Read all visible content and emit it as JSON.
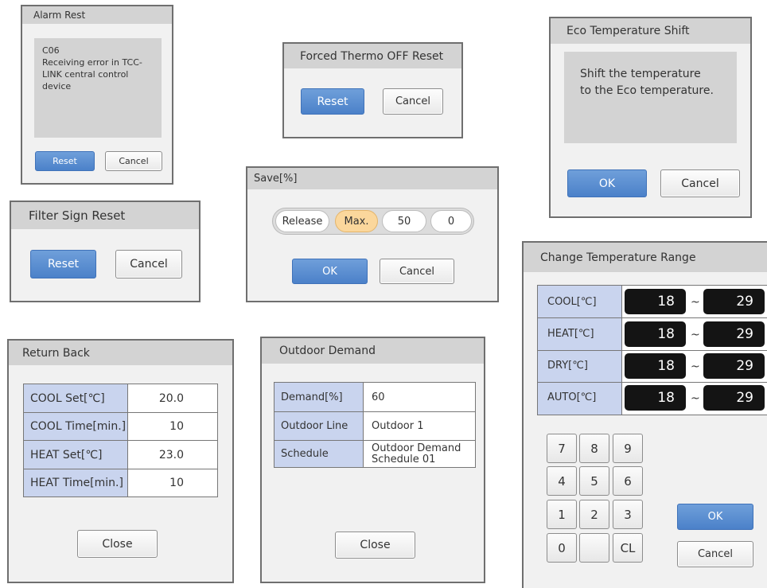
{
  "alarm_reset": {
    "title": "Alarm Rest",
    "code": "C06",
    "message_lines": [
      "Receiving error in TCC-",
      "LINK central control",
      "device"
    ],
    "reset_label": "Reset",
    "cancel_label": "Cancel"
  },
  "forced_thermo": {
    "title": "Forced Thermo OFF Reset",
    "reset_label": "Reset",
    "cancel_label": "Cancel"
  },
  "eco_shift": {
    "title": "Eco Temperature Shift",
    "message_lines": [
      "Shift the temperature",
      "to the Eco  temperature."
    ],
    "ok_label": "OK",
    "cancel_label": "Cancel"
  },
  "save": {
    "title": "Save[%]",
    "options": [
      "Release",
      "Max.",
      "50",
      "0"
    ],
    "selected": "Max.",
    "ok_label": "OK",
    "cancel_label": "Cancel"
  },
  "filter_sign": {
    "title": "Filter Sign Reset",
    "reset_label": "Reset",
    "cancel_label": "Cancel"
  },
  "return_back": {
    "title": "Return Back",
    "rows": [
      {
        "label": "COOL Set[℃]",
        "value": "20.0"
      },
      {
        "label": "COOL Time[min.]",
        "value": "10"
      },
      {
        "label": "HEAT Set[℃]",
        "value": "23.0"
      },
      {
        "label": "HEAT Time[min.]",
        "value": "10"
      }
    ],
    "close_label": "Close"
  },
  "outdoor_demand": {
    "title": "Outdoor Demand",
    "rows": [
      {
        "label": "Demand[%]",
        "value": "60"
      },
      {
        "label": "Outdoor Line",
        "value": "Outdoor 1"
      },
      {
        "label": "Schedule",
        "value_lines": [
          "Outdoor Demand",
          "Schedule 01"
        ]
      }
    ],
    "close_label": "Close"
  },
  "temp_range": {
    "title": "Change Temperature  Range",
    "tilde": "~",
    "rows": [
      {
        "label": "COOL[℃]",
        "min": "18",
        "max": "29"
      },
      {
        "label": "HEAT[℃]",
        "min": "18",
        "max": "29"
      },
      {
        "label": "DRY[℃]",
        "min": "18",
        "max": "29"
      },
      {
        "label": "AUTO[℃]",
        "min": "18",
        "max": "29"
      }
    ],
    "keypad": [
      "7",
      "8",
      "9",
      "4",
      "5",
      "6",
      "1",
      "2",
      "3",
      "0",
      "",
      "CL"
    ],
    "ok_label": "OK",
    "cancel_label": "Cancel"
  }
}
